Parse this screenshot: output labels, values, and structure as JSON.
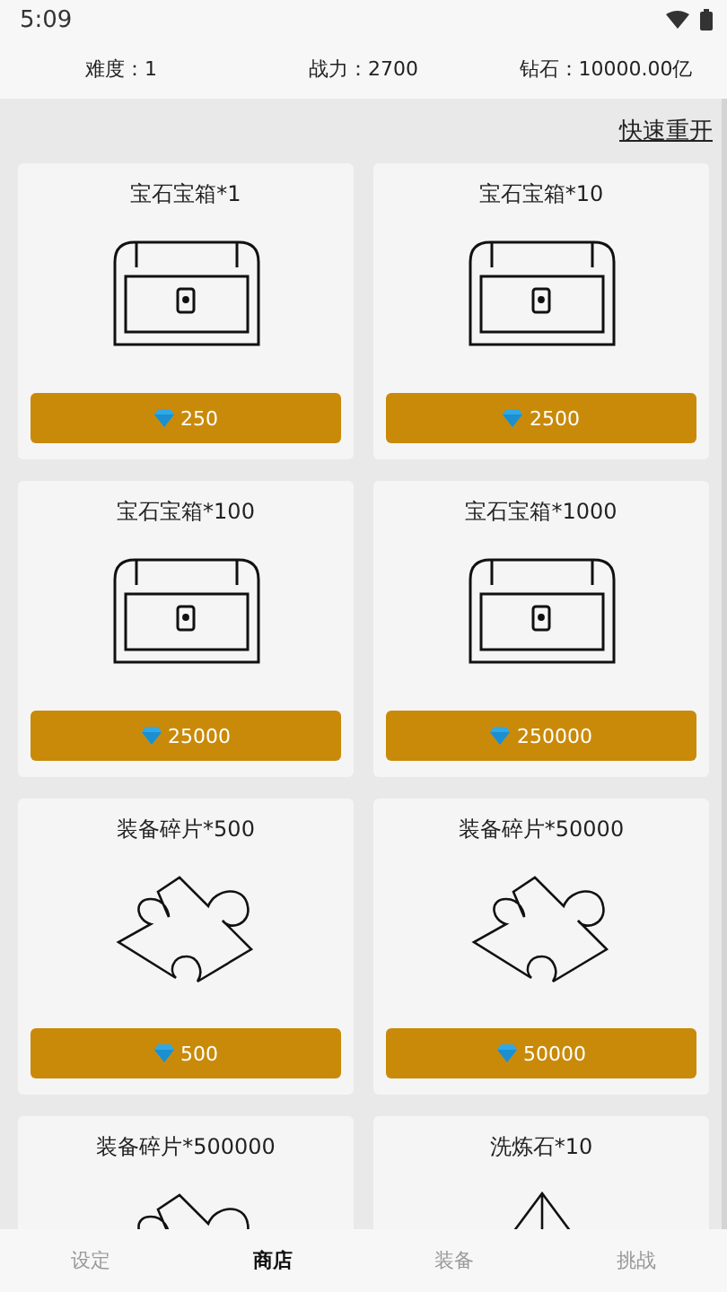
{
  "status_bar": {
    "time": "5:09"
  },
  "stats": [
    "难度：1",
    "战力：2700",
    "钻石：10000.00亿"
  ],
  "quick_restart": "快速重开",
  "items": [
    {
      "kind": "chest",
      "title": "宝石宝箱*1",
      "price": "250"
    },
    {
      "kind": "chest",
      "title": "宝石宝箱*10",
      "price": "2500"
    },
    {
      "kind": "chest",
      "title": "宝石宝箱*100",
      "price": "25000"
    },
    {
      "kind": "chest",
      "title": "宝石宝箱*1000",
      "price": "250000"
    },
    {
      "kind": "puzzle",
      "title": "装备碎片*500",
      "price": "500"
    },
    {
      "kind": "puzzle",
      "title": "装备碎片*50000",
      "price": "50000"
    },
    {
      "kind": "puzzle",
      "title": "装备碎片*500000"
    },
    {
      "kind": "stone",
      "title": "洗炼石*10"
    }
  ],
  "tabs": [
    {
      "label": "设定",
      "selected": false
    },
    {
      "label": "商店",
      "selected": true
    },
    {
      "label": "装备",
      "selected": false
    },
    {
      "label": "挑战",
      "selected": false
    }
  ]
}
